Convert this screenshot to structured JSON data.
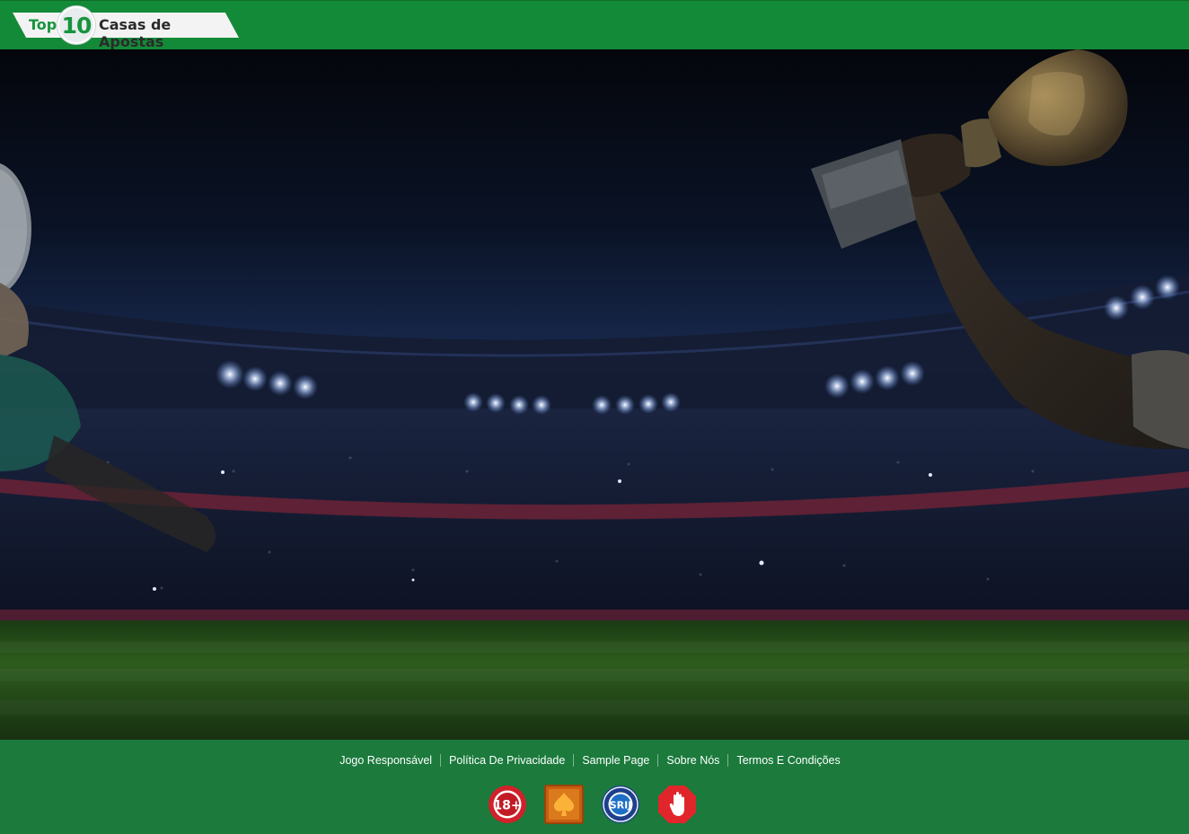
{
  "header": {
    "logo": {
      "top": "Top",
      "number": "10",
      "text": "Casas de Apostas"
    }
  },
  "footer": {
    "links": [
      {
        "label": "Jogo Responsável"
      },
      {
        "label": "Política De Privacidade"
      },
      {
        "label": "Sample Page"
      },
      {
        "label": "Sobre Nós"
      },
      {
        "label": "Termos E Condições"
      }
    ],
    "badges": [
      {
        "name": "age-18-badge",
        "text": "18+"
      },
      {
        "name": "spade-badge"
      },
      {
        "name": "srij-badge",
        "text": "SRIJ"
      },
      {
        "name": "stop-hand-badge"
      }
    ]
  },
  "colors": {
    "header_green": "#138a37",
    "footer_green": "#1b7a3c",
    "logo_green": "#16943e"
  }
}
